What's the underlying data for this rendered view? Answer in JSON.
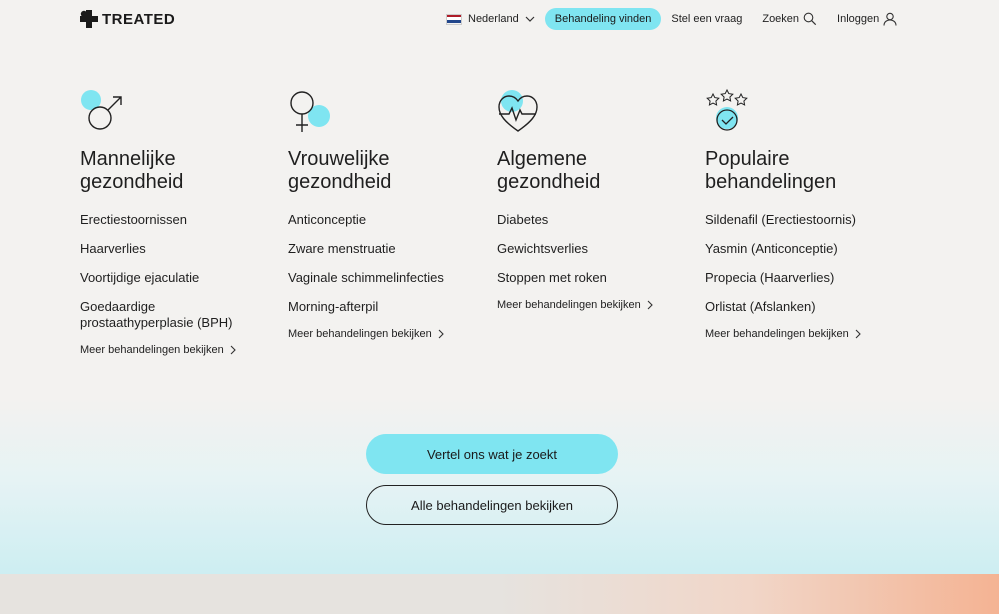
{
  "brand": {
    "name": "TREATED"
  },
  "nav": {
    "language": "Nederland",
    "find_treatment": "Behandeling vinden",
    "ask_question": "Stel een vraag",
    "search": "Zoeken",
    "login": "Inloggen"
  },
  "columns": [
    {
      "icon": "male-symbol-icon",
      "title_line1": "Mannelijke",
      "title_line2": "gezondheid",
      "items": [
        "Erectiestoornissen",
        "Haarverlies",
        "Voortijdige ejaculatie",
        "Goedaardige prostaathyperplasie (BPH)"
      ],
      "more": "Meer behandelingen bekijken"
    },
    {
      "icon": "female-symbol-icon",
      "title_line1": "Vrouwelijke",
      "title_line2": "gezondheid",
      "items": [
        "Anticonceptie",
        "Zware menstruatie",
        "Vaginale schimmelinfecties",
        "Morning-afterpil"
      ],
      "more": "Meer behandelingen bekijken"
    },
    {
      "icon": "heart-pulse-icon",
      "title_line1": "Algemene",
      "title_line2": "gezondheid",
      "items": [
        "Diabetes",
        "Gewichtsverlies",
        "Stoppen met roken"
      ],
      "more": "Meer behandelingen bekijken"
    },
    {
      "icon": "star-rating-icon",
      "title_line1": "Populaire",
      "title_line2": "behandelingen",
      "items": [
        "Sildenafil (Erectiestoornis)",
        "Yasmin (Anticonceptie)",
        "Propecia (Haarverlies)",
        "Orlistat (Afslanken)"
      ],
      "more": "Meer behandelingen bekijken"
    }
  ],
  "cta": {
    "primary": "Vertel ons wat je zoekt",
    "secondary": "Alle behandelingen bekijken"
  },
  "colors": {
    "accent": "#7fe5f1",
    "text": "#1f1f1f",
    "background": "#f3f2f0"
  }
}
